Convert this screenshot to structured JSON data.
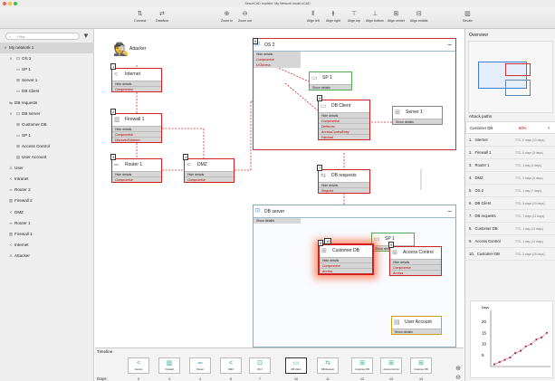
{
  "window_title": "SecuriCAD modeler: My Network model.sCAD",
  "toolbar": [
    {
      "icon": "⇅",
      "label": "Connect"
    },
    {
      "icon": "⇄",
      "label": "Dataflow"
    },
    {
      "icon": "⊕",
      "label": "Zoom in"
    },
    {
      "icon": "⊖",
      "label": "Zoom out"
    },
    {
      "icon": "⫴",
      "label": "Align left"
    },
    {
      "icon": "⫵",
      "label": "Align right"
    },
    {
      "icon": "⊤",
      "label": "Align top"
    },
    {
      "icon": "⊥",
      "label": "Align bottom"
    },
    {
      "icon": "⊞",
      "label": "Align center"
    },
    {
      "icon": "⊟",
      "label": "Align middle"
    },
    {
      "icon": "▥",
      "label": "Sevals"
    }
  ],
  "sidebar": {
    "filter_placeholder": "Filter",
    "items": [
      {
        "icon": "v",
        "label": "My network 1"
      },
      {
        "icon": "⊡",
        "label": "OS 2"
      },
      {
        "icon": "▭",
        "label": "SP 1"
      },
      {
        "icon": "⊞",
        "label": "Server 1"
      },
      {
        "icon": "▭",
        "label": "DB Client"
      },
      {
        "icon": "⇆",
        "label": "DB requests"
      },
      {
        "icon": "⊡",
        "label": "DB server"
      },
      {
        "icon": "⊞",
        "label": "Customer DB"
      },
      {
        "icon": "▭",
        "label": "SP 1"
      },
      {
        "icon": "⊞",
        "label": "Access Control"
      },
      {
        "icon": "▤",
        "label": "User Account"
      },
      {
        "icon": "♙",
        "label": "User"
      },
      {
        "icon": "<",
        "label": "Intranet"
      },
      {
        "icon": "═",
        "label": "Router 2"
      },
      {
        "icon": "▥",
        "label": "Firewall 2"
      },
      {
        "icon": "<",
        "label": "DMZ"
      },
      {
        "icon": "═",
        "label": "Router 1"
      },
      {
        "icon": "▥",
        "label": "Firewall 1"
      },
      {
        "icon": "<",
        "label": "Internet"
      },
      {
        "icon": "♙",
        "label": "Attacker"
      }
    ]
  },
  "canvas": {
    "attacker": "Attacker",
    "hide": "Hide details",
    "show": "Show details",
    "compromise": "Compromise",
    "discover": "DiscoverEntrance",
    "udaccess": "UI Access",
    "defences": "Defences",
    "acr": "AccessControlEntry",
    "patched": "Patched",
    "request": "Request",
    "access": "Access",
    "os2": "OS 2",
    "dbserver": "DB server",
    "internet": "Internet",
    "firewall1": "Firewall 1",
    "router1": "Router 1",
    "dmz": "DMZ",
    "sp1": "SP 1",
    "dbclient": "DB Client",
    "server1": "Server 1",
    "dbrequests": "DB requests",
    "customerdb": "Customer DB",
    "accesscontrol": "Access Control",
    "useraccount": "User Account",
    "n1": "1",
    "n2": "2",
    "n3": "3",
    "n4": "4",
    "n5": "5",
    "n6": "6",
    "n7": "7",
    "n8": "8",
    "n9": "9",
    "n10": "10",
    "n11": "11"
  },
  "right": {
    "overview": "Overview",
    "attack_paths": "Attack paths",
    "header": {
      "label": "Customer DB",
      "pct": "60%"
    },
    "paths": [
      {
        "n": "1.",
        "label": "Internet",
        "ttc": "TTC: 0 days (10 days)"
      },
      {
        "n": "2.",
        "label": "Firewall 1",
        "ttc": "TTC: 0 days (3 days)"
      },
      {
        "n": "3.",
        "label": "Router 1",
        "ttc": "TTC: 1 day (4 days)"
      },
      {
        "n": "4.",
        "label": "DMZ",
        "ttc": "TTC: 2 days (6 days)"
      },
      {
        "n": "5.",
        "label": "OS 2",
        "ttc": "TTC: 1 day (7 days)"
      },
      {
        "n": "6.",
        "label": "DB Client",
        "ttc": "TTC: 3 days (10 days)"
      },
      {
        "n": "7.",
        "label": "DB requests",
        "ttc": "TTC: 7 days (11 days)"
      },
      {
        "n": "8.",
        "label": "Customer DB",
        "ttc": "TTC: 1 day (13 days)"
      },
      {
        "n": "9.",
        "label": "Access Control",
        "ttc": "TTC: 1 day (13 days)"
      },
      {
        "n": "10.",
        "label": "Customer DB",
        "ttc": "TTC: 2 days (15 days)"
      }
    ]
  },
  "chart_data": {
    "type": "line",
    "title": "",
    "ylabel": "Days",
    "xlabel": "",
    "ylim": [
      0,
      25
    ],
    "yticks": [
      "5",
      "10",
      "15",
      "20"
    ],
    "values": [
      1,
      2,
      3,
      4,
      6,
      7,
      9,
      10,
      12,
      13,
      15
    ]
  },
  "timeline": {
    "title": "Timeline",
    "days_label": "Days:",
    "items": [
      {
        "icon": "<",
        "label": "Internet",
        "day": "0"
      },
      {
        "icon": "▥",
        "label": "Firewall",
        "day": "3"
      },
      {
        "icon": "═",
        "label": "Router",
        "day": "4"
      },
      {
        "icon": "<",
        "label": "DMZ",
        "day": "6"
      },
      {
        "icon": "⊡",
        "label": "OS 2",
        "day": "7"
      },
      {
        "icon": "▭",
        "label": "DB Client",
        "day": "10"
      },
      {
        "icon": "⇆",
        "label": "DB Request",
        "day": "11"
      },
      {
        "icon": "⊞",
        "label": "Customer DB",
        "day": "12"
      },
      {
        "icon": "⊞",
        "label": "Access Control",
        "day": "13"
      },
      {
        "icon": "⊞",
        "label": "Customer DB",
        "day": "13"
      }
    ]
  }
}
